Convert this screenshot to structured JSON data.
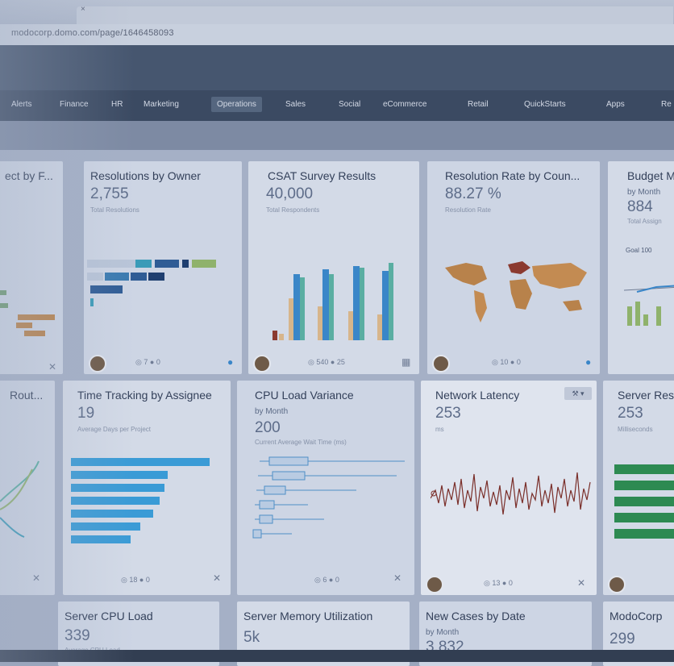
{
  "browser": {
    "url": "modocorp.domo.com/page/1646458093",
    "tab_close": "×"
  },
  "nav": {
    "items": [
      "Alerts",
      "Finance",
      "HR",
      "Marketing",
      "Operations",
      "Sales",
      "Social",
      "eCommerce",
      "Retail",
      "QuickStarts",
      "Apps",
      "Re"
    ],
    "active": "Operations"
  },
  "cards": {
    "c1": {
      "title": "ect by F..."
    },
    "c2": {
      "title": "Resolutions by Owner",
      "value": "2,755",
      "sublabel": "Total Resolutions",
      "views": "7",
      "comments": "0"
    },
    "c3": {
      "title": "CSAT Survey Results",
      "value": "40,000",
      "sublabel": "Total Respondents",
      "views": "540",
      "comments": "25"
    },
    "c4": {
      "title": "Resolution Rate by Coun...",
      "value": "88.27 %",
      "sublabel": "Resolution Rate",
      "views": "10",
      "comments": "0"
    },
    "c5": {
      "title": "Budget M",
      "subtitle": "by Month",
      "value": "884",
      "sublabel": "Total Assign",
      "goal": "Goal 100"
    },
    "c6": {
      "title": "Rout..."
    },
    "c7": {
      "title": "Time Tracking by Assignee",
      "value": "19",
      "sublabel": "Average Days per Project",
      "views": "18",
      "comments": "0"
    },
    "c8": {
      "title": "CPU Load Variance",
      "subtitle": "by Month",
      "value": "200",
      "sublabel": "Current Average Wait Time (ms)",
      "views": "6",
      "comments": "0"
    },
    "c9": {
      "title": "Network Latency",
      "value": "253",
      "sublabel": "ms",
      "views": "13",
      "comments": "0"
    },
    "c10": {
      "title": "Server Res",
      "value": "253",
      "sublabel": "Milliseconds"
    },
    "c11": {
      "title": "Server CPU Load",
      "value": "339",
      "sublabel": "Average CPU Load"
    },
    "c12": {
      "title": "Server Memory Utilization",
      "value": "5k"
    },
    "c13": {
      "title": "New Cases by Date",
      "subtitle": "by Month",
      "value": "3,832"
    },
    "c14": {
      "title": "ModoCorp",
      "value": "299"
    }
  },
  "colors": {
    "header": "#46566f",
    "nav": "#3b4a62",
    "card": "#cdd5e4",
    "accent": "#3a9bb8"
  }
}
